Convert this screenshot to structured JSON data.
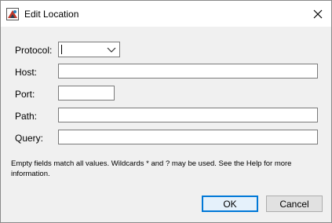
{
  "window": {
    "title": "Edit Location",
    "app_icon": "app-icon",
    "close_icon": "close-icon"
  },
  "form": {
    "protocol": {
      "label": "Protocol:",
      "selected": ""
    },
    "host": {
      "label": "Host:",
      "value": ""
    },
    "port": {
      "label": "Port:",
      "value": ""
    },
    "path": {
      "label": "Path:",
      "value": ""
    },
    "query": {
      "label": "Query:",
      "value": ""
    }
  },
  "note": "Empty fields match all values. Wildcards * and ? may be used. See the Help for more information.",
  "buttons": {
    "ok": "OK",
    "cancel": "Cancel"
  },
  "colors": {
    "accent": "#0078d7"
  }
}
